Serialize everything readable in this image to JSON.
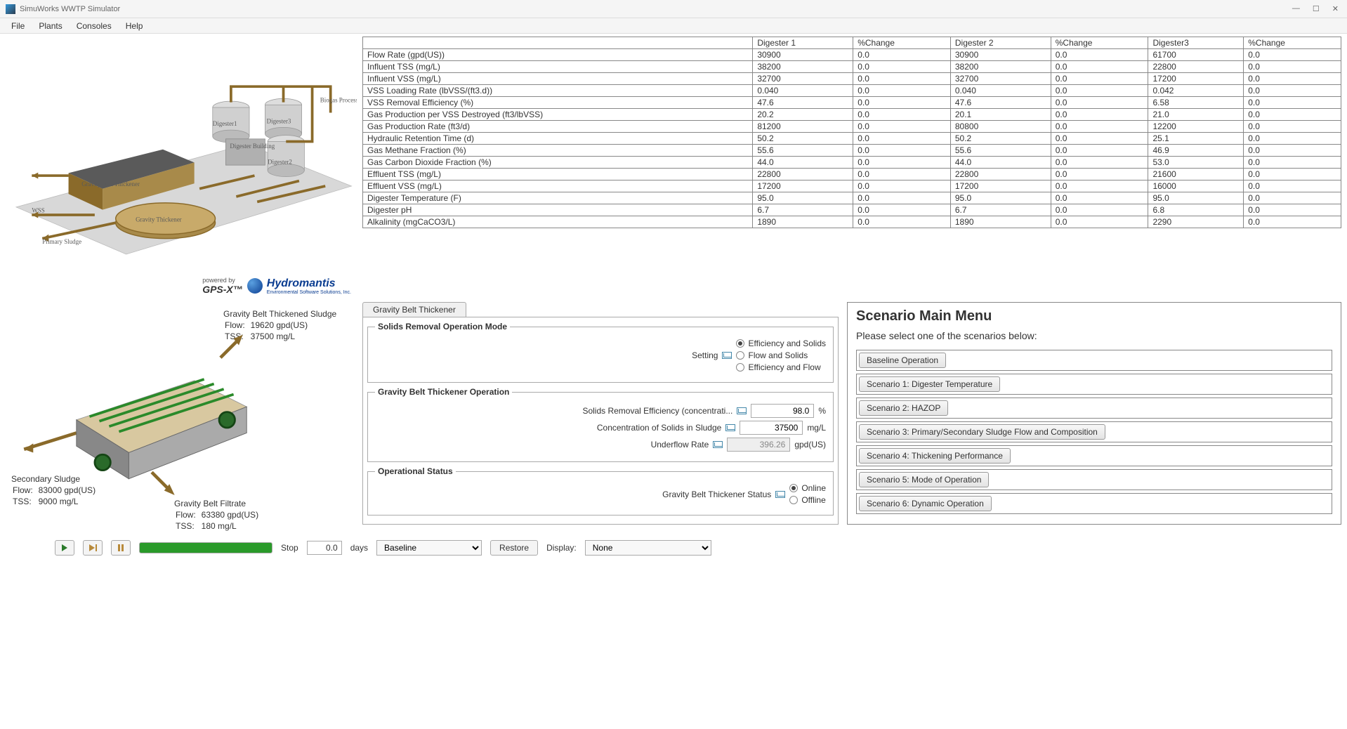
{
  "app_title": "SimuWorks WWTP Simulator",
  "menu": [
    "File",
    "Plants",
    "Consoles",
    "Help"
  ],
  "plant_labels": {
    "biogas": "Biogas Processing",
    "d1": "Digester1",
    "d2": "Digester2",
    "d3": "Digester3",
    "dbuild": "Digester Building",
    "gbt": "Gravity Belt Thickener",
    "gt": "Gravity Thickener",
    "wss": "WSS",
    "primary": "Primary Sludge"
  },
  "logo": {
    "powered": "powered by",
    "brand1": "GPS-X™",
    "brand2": "Hydromantis",
    "tag": "Environmental Software Solutions, Inc."
  },
  "table": {
    "headers": [
      "",
      "Digester 1",
      "%Change",
      "Digester 2",
      "%Change",
      "Digester3",
      "%Change"
    ],
    "rows": [
      [
        "Flow Rate (gpd(US))",
        "30900",
        "0.0",
        "30900",
        "0.0",
        "61700",
        "0.0"
      ],
      [
        "Influent TSS (mg/L)",
        "38200",
        "0.0",
        "38200",
        "0.0",
        "22800",
        "0.0"
      ],
      [
        "Influent VSS (mg/L)",
        "32700",
        "0.0",
        "32700",
        "0.0",
        "17200",
        "0.0"
      ],
      [
        "VSS Loading Rate (lbVSS/(ft3.d))",
        "0.040",
        "0.0",
        "0.040",
        "0.0",
        "0.042",
        "0.0"
      ],
      [
        "VSS Removal Efficiency (%)",
        "47.6",
        "0.0",
        "47.6",
        "0.0",
        "6.58",
        "0.0"
      ],
      [
        "Gas Production per VSS Destroyed (ft3/lbVSS)",
        "20.2",
        "0.0",
        "20.1",
        "0.0",
        "21.0",
        "0.0"
      ],
      [
        "Gas Production Rate (ft3/d)",
        "81200",
        "0.0",
        "80800",
        "0.0",
        "12200",
        "0.0"
      ],
      [
        "Hydraulic Retention Time (d)",
        "50.2",
        "0.0",
        "50.2",
        "0.0",
        "25.1",
        "0.0"
      ],
      [
        "Gas Methane Fraction (%)",
        "55.6",
        "0.0",
        "55.6",
        "0.0",
        "46.9",
        "0.0"
      ],
      [
        "Gas Carbon Dioxide Fraction (%)",
        "44.0",
        "0.0",
        "44.0",
        "0.0",
        "53.0",
        "0.0"
      ],
      [
        "Effluent TSS (mg/L)",
        "22800",
        "0.0",
        "22800",
        "0.0",
        "21600",
        "0.0"
      ],
      [
        "Effluent VSS (mg/L)",
        "17200",
        "0.0",
        "17200",
        "0.0",
        "16000",
        "0.0"
      ],
      [
        "Digester Temperature (F)",
        "95.0",
        "0.0",
        "95.0",
        "0.0",
        "95.0",
        "0.0"
      ],
      [
        "Digester pH",
        "6.7",
        "0.0",
        "6.7",
        "0.0",
        "6.8",
        "0.0"
      ],
      [
        "Alkalinity (mgCaCO3/L)",
        "1890",
        "0.0",
        "1890",
        "0.0",
        "2290",
        "0.0"
      ]
    ]
  },
  "gbt_detail": {
    "thickened": {
      "title": "Gravity Belt Thickened Sludge",
      "flow_lbl": "Flow:",
      "flow": "19620 gpd(US)",
      "tss_lbl": "TSS:",
      "tss": "37500 mg/L"
    },
    "secondary": {
      "title": "Secondary Sludge",
      "flow_lbl": "Flow:",
      "flow": "83000 gpd(US)",
      "tss_lbl": "TSS:",
      "tss": "9000 mg/L"
    },
    "filtrate": {
      "title": "Gravity Belt Filtrate",
      "flow_lbl": "Flow:",
      "flow": "63380 gpd(US)",
      "tss_lbl": "TSS:",
      "tss": "180 mg/L"
    }
  },
  "tab_label": "Gravity Belt Thickener",
  "f1": {
    "legend": "Solids Removal Operation Mode",
    "setting_lbl": "Setting",
    "opts": [
      "Efficiency and Solids",
      "Flow and Solids",
      "Efficiency and Flow"
    ]
  },
  "f2": {
    "legend": "Gravity Belt Thickener Operation",
    "r1_lbl": "Solids Removal Efficiency (concentrati...",
    "r1_val": "98.0",
    "r1_unit": "%",
    "r2_lbl": "Concentration of Solids in Sludge",
    "r2_val": "37500",
    "r2_unit": "mg/L",
    "r3_lbl": "Underflow Rate",
    "r3_val": "396.26",
    "r3_unit": "gpd(US)"
  },
  "f3": {
    "legend": "Operational Status",
    "lbl": "Gravity Belt Thickener Status",
    "opts": [
      "Online",
      "Offline"
    ]
  },
  "scenario": {
    "title": "Scenario Main Menu",
    "prompt": "Please select one of the scenarios below:",
    "items": [
      "Baseline Operation",
      "Scenario 1: Digester Temperature",
      "Scenario 2: HAZOP",
      "Scenario 3: Primary/Secondary Sludge Flow and Composition",
      "Scenario 4: Thickening Performance",
      "Scenario 5: Mode of Operation",
      "Scenario 6: Dynamic Operation"
    ]
  },
  "sim": {
    "stop": "Stop",
    "time": "0.0",
    "time_unit": "days",
    "cb1": "Baseline",
    "restore": "Restore",
    "display": "Display:",
    "cb2": "None"
  }
}
